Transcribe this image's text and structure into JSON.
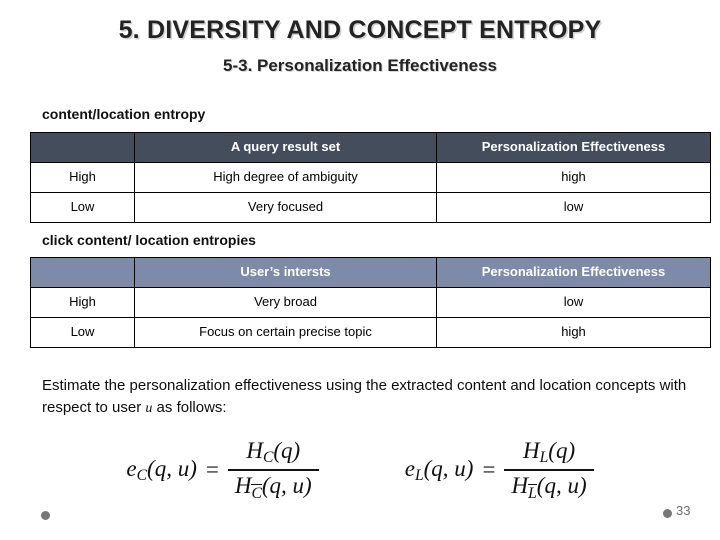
{
  "slide": {
    "title": "5. DIVERSITY AND CONCEPT ENTROPY",
    "subtitle": "5-3. Personalization Effectiveness",
    "page_number": "33",
    "title_color": "#232323",
    "dot_color": "#787878"
  },
  "section_1": {
    "caption": "content/location entropy",
    "header_bg": "#434D5C",
    "table": {
      "headers": [
        "",
        "A query result set",
        "Personalization Effectiveness"
      ],
      "rows": [
        [
          "High",
          "High degree of ambiguity",
          "high"
        ],
        [
          "Low",
          "Very focused",
          "low"
        ]
      ]
    }
  },
  "section_2": {
    "caption": "click content/ location entropies",
    "header_bg": "#7E8BA8",
    "table": {
      "headers": [
        "",
        "User’s intersts",
        "Personalization Effectiveness"
      ],
      "rows": [
        [
          "High",
          "Very broad",
          "low"
        ],
        [
          "Low",
          "Focus on certain precise topic",
          "high"
        ]
      ]
    }
  },
  "body": {
    "text_before_var": "Estimate the personalization effectiveness using the extracted content and location concepts with respect to user ",
    "variable": "u",
    "text_after_var": " as follows:"
  },
  "formulas": [
    {
      "id": "content-effectiveness",
      "lhs_base": "e",
      "lhs_sub": "C",
      "lhs_args": "(q, u)",
      "equals": "=",
      "numerator_base": "H",
      "numerator_sub": "C",
      "numerator_args": "(q)",
      "denominator_base": "H",
      "denominator_sub": "C",
      "denominator_sub_overline": true,
      "denominator_args": "(q, u)"
    },
    {
      "id": "location-effectiveness",
      "lhs_base": "e",
      "lhs_sub": "L",
      "lhs_args": "(q, u)",
      "equals": "=",
      "numerator_base": "H",
      "numerator_sub": "L",
      "numerator_args": "(q)",
      "denominator_base": "H",
      "denominator_sub": "L",
      "denominator_sub_overline": true,
      "denominator_args": "(q, u)"
    }
  ]
}
